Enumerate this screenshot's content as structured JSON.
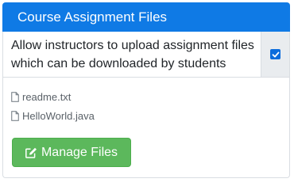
{
  "card": {
    "title": "Course Assignment Files"
  },
  "upload_option": {
    "label_line1": "Allow instructors to upload assignment files",
    "label_line2": "which can be downloaded by students",
    "checked": true
  },
  "files": [
    {
      "name": "readme.txt",
      "icon": "file-icon"
    },
    {
      "name": "HelloWorld.java",
      "icon": "file-icon"
    }
  ],
  "manage_button": {
    "label": "Manage Files",
    "icon": "edit-icon"
  },
  "colors": {
    "header": "#0f7ae5",
    "checkbox": "#0b6cdc",
    "button": "#5cb85c"
  }
}
